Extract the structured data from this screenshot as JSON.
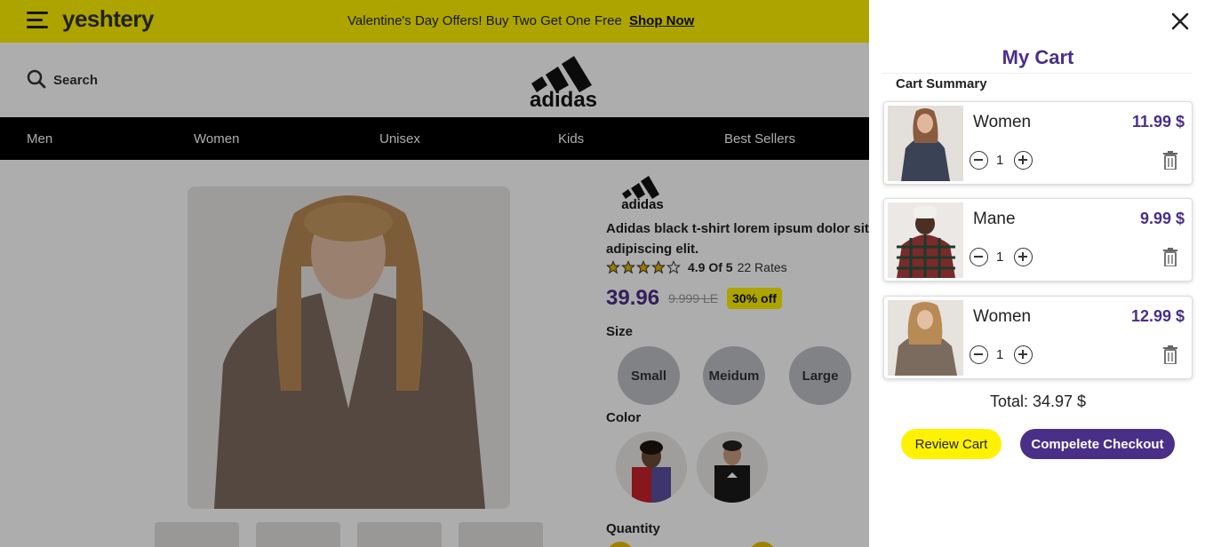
{
  "promo": {
    "logo": "yeshtery",
    "text": "Valentine's Day Offers! Buy Two Get One Free",
    "link": "Shop Now"
  },
  "header": {
    "search_label": "Search",
    "brand_logo": "adidas"
  },
  "nav": {
    "items": [
      "Men",
      "Women",
      "Unisex",
      "Kids",
      "Best Sellers"
    ]
  },
  "product": {
    "brand": "adidas",
    "title": "Adidas black t-shirt lorem ipsum dolor sit adipiscing elit.",
    "rating_stars": 4,
    "rating_text": "4.9 Of 5",
    "rating_count": "22 Rates",
    "price": "39.96",
    "old_price": "9.999 LE",
    "discount": "30% off",
    "size_label": "Size",
    "sizes": [
      "Small",
      "Meidum",
      "Large"
    ],
    "color_label": "Color",
    "quantity_label": "Quantity"
  },
  "cart": {
    "title": "My Cart",
    "summary_label": "Cart Summary",
    "items": [
      {
        "name": "Women",
        "price": "11.99 $",
        "qty": "1"
      },
      {
        "name": "Mane",
        "price": "9.99 $",
        "qty": "1"
      },
      {
        "name": "Women",
        "price": "12.99 $",
        "qty": "1"
      }
    ],
    "total": "Total: 34.97 $",
    "review_label": "Review Cart",
    "checkout_label": "Compelete Checkout"
  },
  "colors": {
    "brand_yellow": "#fff200",
    "brand_purple": "#4a2f88",
    "nav_black": "#000000"
  }
}
